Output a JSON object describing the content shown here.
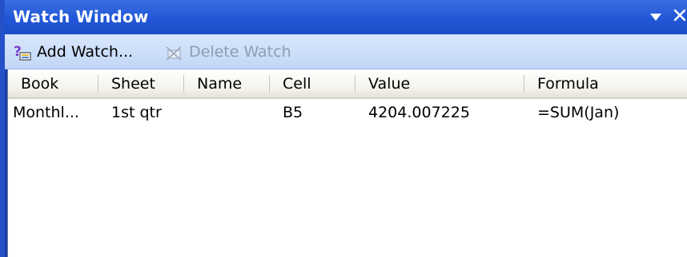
{
  "window": {
    "title": "Watch Window",
    "menu_glyph": "▼",
    "close_glyph": "✕"
  },
  "toolbar": {
    "add_watch_label": "Add Watch...",
    "delete_watch_label": "Delete Watch",
    "delete_enabled": false
  },
  "columns": [
    "Book",
    "Sheet",
    "Name",
    "Cell",
    "Value",
    "Formula"
  ],
  "rows": [
    {
      "book": "Monthl...",
      "sheet": "1st qtr",
      "name": "",
      "cell": "B5",
      "value": "4204.007225",
      "formula": "=SUM(Jan)"
    }
  ],
  "colors": {
    "title_bar": "#2157d8",
    "toolbar": "#c2d7f7",
    "disabled_text": "#8f9bb0"
  },
  "icons": {
    "add_watch": "add-watch-icon",
    "delete_watch": "delete-watch-icon",
    "menu": "dropdown-arrow-icon",
    "close": "close-icon"
  }
}
